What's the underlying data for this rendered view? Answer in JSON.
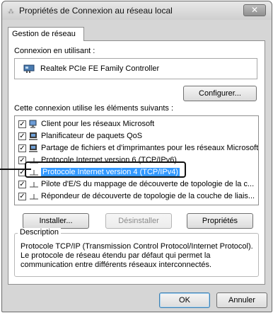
{
  "window": {
    "title": "Propriétés de Connexion au réseau local",
    "close_glyph": "✕"
  },
  "tab": {
    "label": "Gestion de réseau"
  },
  "connect": {
    "label": "Connexion en utilisant :",
    "adapter": "Realtek PCIe FE Family Controller"
  },
  "buttons": {
    "configure": "Configurer...",
    "install": "Installer...",
    "uninstall": "Désinstaller",
    "properties": "Propriétés",
    "ok": "OK",
    "cancel": "Annuler"
  },
  "items_label": "Cette connexion utilise les éléments suivants :",
  "items": [
    {
      "label": "Client pour les réseaux Microsoft",
      "checked": true,
      "icon": "network-client-icon"
    },
    {
      "label": "Planificateur de paquets QoS",
      "checked": true,
      "icon": "scheduler-icon"
    },
    {
      "label": "Partage de fichiers et d'imprimantes pour les réseaux Microsoft",
      "checked": true,
      "icon": "file-printer-sharing-icon"
    },
    {
      "label": "Protocole Internet version 6 (TCP/IPv6)",
      "checked": true,
      "icon": "protocol-icon"
    },
    {
      "label": "Protocole Internet version 4 (TCP/IPv4)",
      "checked": true,
      "icon": "protocol-icon",
      "selected": true
    },
    {
      "label": "Pilote d'E/S du mappage de découverte de topologie de la c...",
      "checked": true,
      "icon": "protocol-icon"
    },
    {
      "label": "Répondeur de découverte de topologie de la couche de liais...",
      "checked": true,
      "icon": "protocol-icon"
    }
  ],
  "description": {
    "legend": "Description",
    "text": "Protocole TCP/IP (Transmission Control Protocol/Internet Protocol). Le protocole de réseau étendu par défaut qui permet la communication entre différents réseaux interconnectés."
  },
  "check_glyph": "✓"
}
